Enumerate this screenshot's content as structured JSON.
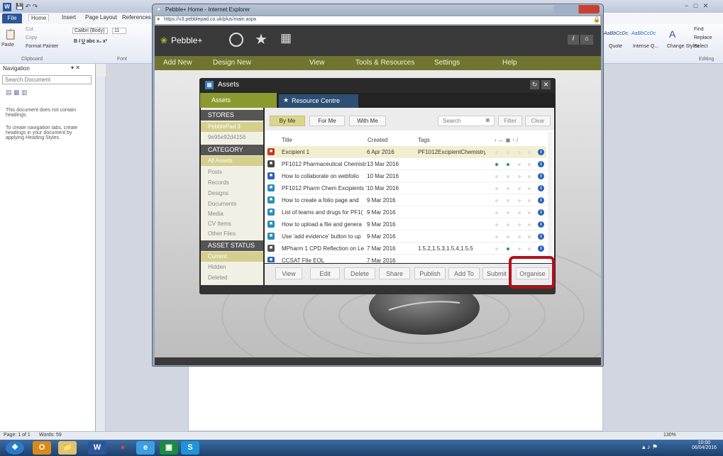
{
  "word": {
    "tabs": [
      "File",
      "Home",
      "Insert",
      "Page Layout",
      "References"
    ],
    "clipboard": {
      "paste": "Paste",
      "cut": "Cut",
      "copy": "Copy",
      "format_painter": "Format Painter",
      "group": "Clipboard"
    },
    "font": {
      "name": "Calibri (Body)",
      "size": "11",
      "group": "Font"
    },
    "styles": {
      "style1": "AaBbCcDc",
      "style2": "AaBbCcDc",
      "quote": "Quote",
      "intense": "Intense Q...",
      "change_styles": "Change Styles"
    },
    "editing": {
      "find": "Find",
      "replace": "Replace",
      "select": "Select",
      "group": "Editing"
    },
    "navigation": {
      "title": "Navigation",
      "search_placeholder": "Search Document",
      "message": "This document does not contain headings.",
      "hint": "To create navigation tabs, create headings in your document by applying Heading Styles."
    },
    "status": {
      "page": "Page: 1 of 1",
      "words": "Words: 59",
      "zoom": "130%"
    },
    "clock": {
      "time": "10:00",
      "date": "06/04/2016"
    }
  },
  "ie": {
    "title": "Pebble+ Home - Internet Explorer",
    "url": "https://v3.pebblepad.co.uk/plus/main.aspx"
  },
  "pebble": {
    "logo": "Pebble+",
    "menu": [
      "Add New",
      "Design New",
      "View",
      "Tools & Resources",
      "Settings",
      "Help"
    ]
  },
  "assets": {
    "title": "Assets",
    "tab_assets": "Assets",
    "tab_resource": "Resource Centre",
    "stores_header": "STORES",
    "stores": [
      "PebblePad 3",
      "9e95e92d4156"
    ],
    "category_header": "CATEGORY",
    "categories": [
      "All Assets",
      "Posts",
      "Records",
      "Designs",
      "Documents",
      "Media",
      "CV Items",
      "Other Files"
    ],
    "status_header": "ASSET STATUS",
    "statuses": [
      "Current",
      "Hidden",
      "Deleted"
    ],
    "filters": {
      "by_me": "By Me",
      "for_me": "For Me",
      "with_me": "With Me",
      "search_placeholder": "Search",
      "filter": "Filter",
      "clear": "Clear"
    },
    "columns": {
      "title": "Title",
      "created": "Created",
      "tags": "Tags"
    },
    "rows": [
      {
        "title": "Excipient 1",
        "created": "6 Apr 2016",
        "tags": "PF1012ExcipientChemistry",
        "icon_color": "#c0392b",
        "dots": [
          0,
          0,
          0,
          0
        ]
      },
      {
        "title": "PF1012 Pharmaceutical Chemistr",
        "created": "13 Mar 2016",
        "tags": "",
        "icon_color": "#444444",
        "dots": [
          1,
          1,
          0,
          0
        ]
      },
      {
        "title": "How to collaborate on webfolio",
        "created": "10 Mar 2016",
        "tags": "",
        "icon_color": "#2b63b8",
        "dots": [
          0,
          0,
          0,
          0
        ]
      },
      {
        "title": "PF1012 Pharm Chem Excipients '",
        "created": "10 Mar 2016",
        "tags": "",
        "icon_color": "#2b8fb8",
        "dots": [
          0,
          0,
          0,
          0
        ]
      },
      {
        "title": "How to create a folio page and",
        "created": "9 Mar 2016",
        "tags": "",
        "icon_color": "#2b8fb8",
        "dots": [
          0,
          0,
          0,
          0
        ]
      },
      {
        "title": "List of teams and drugs for PF1(",
        "created": "9 Mar 2016",
        "tags": "",
        "icon_color": "#2b8fb8",
        "dots": [
          0,
          0,
          0,
          0
        ]
      },
      {
        "title": "How to upload a file and genera",
        "created": "9 Mar 2016",
        "tags": "",
        "icon_color": "#2b8fb8",
        "dots": [
          0,
          0,
          0,
          0
        ]
      },
      {
        "title": "Use 'add evidence' button to up",
        "created": "9 Mar 2016",
        "tags": "",
        "icon_color": "#2b8fb8",
        "dots": [
          0,
          0,
          0,
          0
        ]
      },
      {
        "title": "MPharm 1 CPD Reflection on Le",
        "created": "7 Mar 2016",
        "tags": "1.5.2,1.5.3,1.5.4,1.5.5",
        "icon_color": "#555555",
        "dots": [
          0,
          1,
          0,
          0
        ]
      },
      {
        "title": "CCSAT FIle EOL",
        "created": "7 Mar 2016",
        "tags": "",
        "icon_color": "#2b63b8",
        "dots": [
          0,
          0,
          0,
          0
        ]
      }
    ],
    "actions": [
      "View",
      "Edit",
      "Delete",
      "Share",
      "Publish",
      "Add To",
      "Submit",
      "Organise"
    ],
    "highlight_color": "#b4101c"
  }
}
